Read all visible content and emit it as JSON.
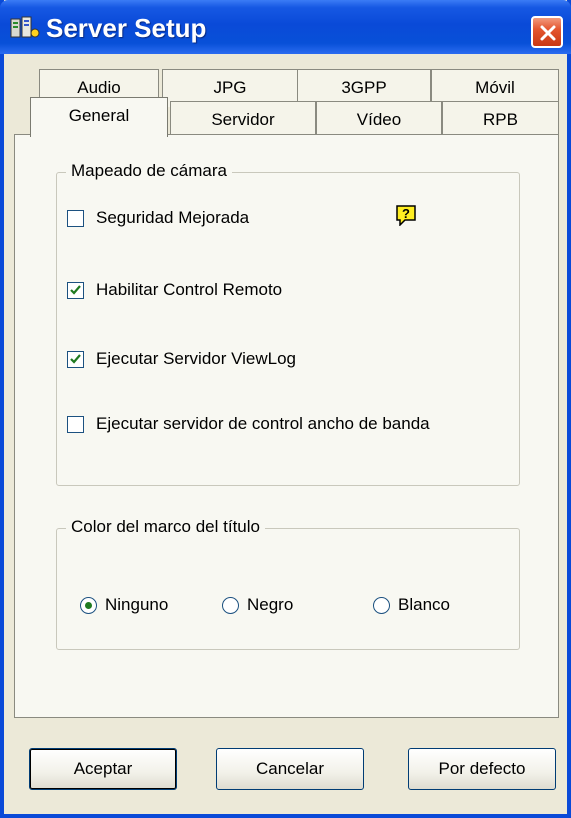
{
  "window": {
    "title": "Server Setup",
    "colors": {
      "titlebar": "#0a4ad8",
      "close": "#e4562f",
      "dialog_bg": "#ece9d8"
    },
    "icons": {
      "app": "server-setup-icon",
      "close": "close-icon"
    }
  },
  "tabs": {
    "back_row": [
      "Audio",
      "JPG",
      "3GPP",
      "Móvil"
    ],
    "front_row": [
      "General",
      "Servidor",
      "Vídeo",
      "RPB"
    ],
    "selected": "General"
  },
  "camera_group": {
    "legend": "Mapeado de cámara",
    "options": [
      {
        "label": "Seguridad Mejorada",
        "checked": false
      },
      {
        "label": "Habilitar Control Remoto",
        "checked": true
      },
      {
        "label": "Ejecutar Servidor ViewLog",
        "checked": true
      },
      {
        "label": "Ejecutar servidor de control ancho de banda",
        "checked": false
      }
    ],
    "help_icon": "help-question-icon"
  },
  "frame_color_group": {
    "legend": "Color del marco del título",
    "options": [
      {
        "label": "Ninguno",
        "selected": true
      },
      {
        "label": "Negro",
        "selected": false
      },
      {
        "label": "Blanco",
        "selected": false
      }
    ]
  },
  "buttons": {
    "accept": "Aceptar",
    "cancel": "Cancelar",
    "defaults": "Por defecto"
  }
}
